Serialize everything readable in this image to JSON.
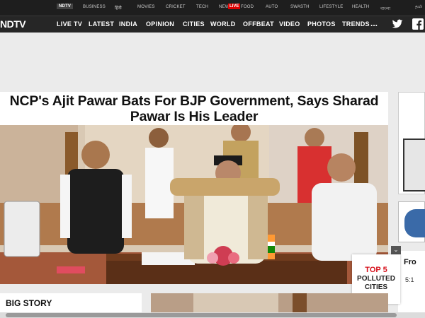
{
  "topbar": {
    "items": [
      {
        "label": "NDTV",
        "active": true
      },
      {
        "label": "BUSINESS"
      },
      {
        "label": "हिंदी"
      },
      {
        "label": "MOVIES"
      },
      {
        "label": "CRICKET"
      },
      {
        "label": "TECH"
      },
      {
        "label": "NEW"
      },
      {
        "label": "FOOD"
      },
      {
        "label": "AUTO"
      },
      {
        "label": "SWASTH"
      },
      {
        "label": "LIFESTYLE"
      },
      {
        "label": "HEALTH"
      },
      {
        "label": "বাংলা"
      },
      {
        "label": "தமி"
      }
    ],
    "live_badge": "LIVE"
  },
  "navbar": {
    "logo": "NDTV",
    "items": [
      "LIVE TV",
      "LATEST",
      "INDIA",
      "OPINION",
      "CITIES",
      "WORLD",
      "OFFBEAT",
      "VIDEO",
      "PHOTOS",
      "TRENDS"
    ],
    "more": "...",
    "social_icons": [
      "twitter-icon",
      "facebook-icon"
    ]
  },
  "article": {
    "headline": "NCP's Ajit Pawar Bats For BJP Government, Says Sharad Pawar Is His Leader"
  },
  "popup": {
    "line1": "TOP 5",
    "line2": "POLLUTED CITIES"
  },
  "right_rail": {
    "teaser_text": "Fro",
    "teaser_time": "5:1"
  },
  "sections": {
    "big_story": "BIG STORY"
  },
  "colors": {
    "accent_red": "#d6101b",
    "nav_bg": "#262626",
    "top_bg": "#1e1e1e"
  }
}
